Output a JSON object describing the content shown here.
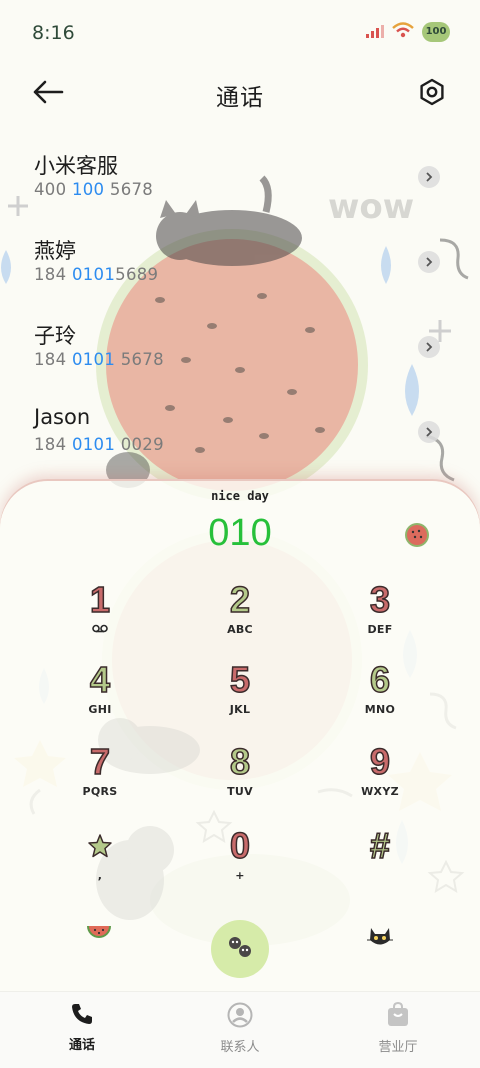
{
  "status_bar": {
    "time": "8:16",
    "battery": "100",
    "signal_icon": "cellular-signal-icon",
    "wifi_icon": "wifi-icon"
  },
  "header": {
    "title": "通话",
    "back_icon": "back-arrow-icon",
    "settings_icon": "settings-gear-icon"
  },
  "call_list": [
    {
      "name": "小米客服",
      "number_pre": "400 ",
      "number_match": "100",
      "number_post": " 5678"
    },
    {
      "name": "燕婷",
      "number_pre": "184 ",
      "number_match": "0101",
      "number_post": "5689"
    },
    {
      "name": "子玲",
      "number_pre": "184 ",
      "number_match": "0101",
      "number_post": " 5678"
    },
    {
      "name": "Jason",
      "number_pre": "184 ",
      "number_match": "0101",
      "number_post": " 0029"
    }
  ],
  "dialer": {
    "caption": "nice day",
    "input": "010",
    "theme_icon": "watermelon-theme-icon",
    "keys": [
      {
        "digit": "1",
        "letters": "",
        "color": "red",
        "icon": "voicemail-icon"
      },
      {
        "digit": "2",
        "letters": "ABC",
        "color": "green"
      },
      {
        "digit": "3",
        "letters": "DEF",
        "color": "red"
      },
      {
        "digit": "4",
        "letters": "GHI",
        "color": "green"
      },
      {
        "digit": "5",
        "letters": "JKL",
        "color": "red"
      },
      {
        "digit": "6",
        "letters": "MNO",
        "color": "green"
      },
      {
        "digit": "7",
        "letters": "PQRS",
        "color": "red"
      },
      {
        "digit": "8",
        "letters": "TUV",
        "color": "green"
      },
      {
        "digit": "9",
        "letters": "WXYZ",
        "color": "red"
      },
      {
        "digit": "",
        "letters": ",",
        "color": "green",
        "icon": "star-icon"
      },
      {
        "digit": "0",
        "letters": "+",
        "color": "red"
      },
      {
        "digit": "#",
        "letters": "",
        "color": "green"
      }
    ]
  },
  "bottom_actions": {
    "left_icon": "watermelon-slice-icon",
    "call_icon": "call-button-icon",
    "right_icon": "cat-menu-icon"
  },
  "nav": [
    {
      "label": "通话",
      "icon": "phone-icon",
      "active": true
    },
    {
      "label": "联系人",
      "icon": "contact-icon",
      "active": false
    },
    {
      "label": "营业厅",
      "icon": "shopping-bag-icon",
      "active": false
    }
  ],
  "colors": {
    "accent_green": "#27c03a",
    "match_blue": "#2d8cf0",
    "key_red": "#c86b6b",
    "key_green": "#b4c98a",
    "call_button": "#d6eba9",
    "background": "#fbfbf5"
  }
}
